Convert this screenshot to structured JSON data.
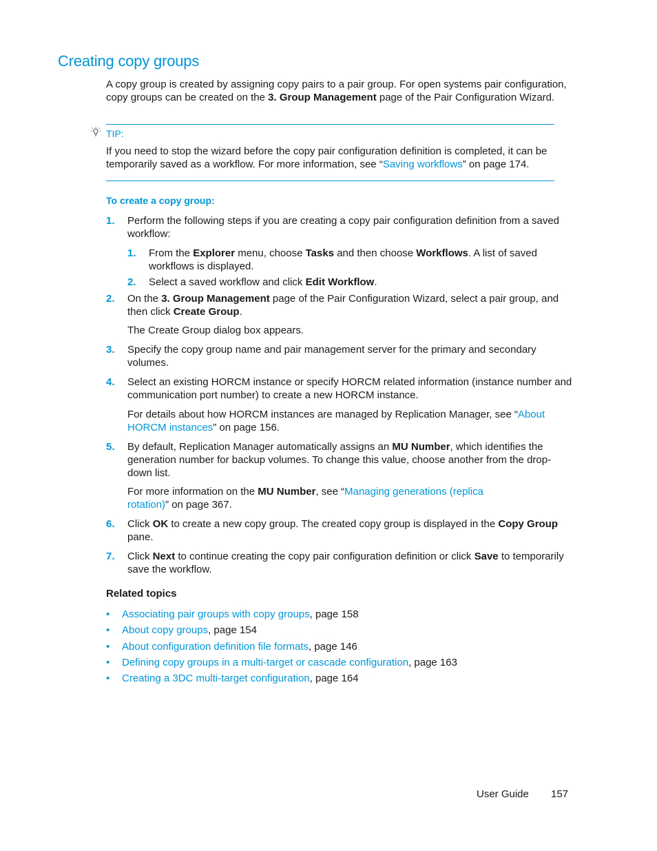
{
  "title": "Creating copy groups",
  "intro": {
    "t1": "A copy group is created by assigning copy pairs to a pair group. For open systems pair configuration, copy groups can be created on the ",
    "b1": "3. Group Management",
    "t2": " page of the Pair Configuration Wizard."
  },
  "tip": {
    "icon": "lightbulb-icon",
    "label": "TIP:",
    "t1": "If you need to stop the wizard before the copy pair configuration definition is completed, it can be temporarily saved as a workflow. For more information, see “",
    "link": "Saving workflows",
    "t2": "” on page 174."
  },
  "procedure": {
    "heading": "To create a copy group:",
    "steps": [
      {
        "num": "1.",
        "text": "Perform the following steps if you are creating a copy pair configuration definition from a saved workflow:",
        "substeps": [
          {
            "num": "1.",
            "t1": "From the ",
            "b1": "Explorer",
            "t2": " menu, choose ",
            "b2": "Tasks",
            "t3": " and then choose ",
            "b3": "Workflows",
            "t4": ". A list of saved workflows is displayed."
          },
          {
            "num": "2.",
            "t1": "Select a saved workflow and click ",
            "b1": "Edit Workflow",
            "t2": "."
          }
        ]
      },
      {
        "num": "2.",
        "t1": "On the ",
        "b1": "3. Group Management",
        "t2": " page of the Pair Configuration Wizard, select a pair group, and then click ",
        "b2": "Create Group",
        "t3": ".",
        "note": "The Create Group dialog box appears."
      },
      {
        "num": "3.",
        "text": "Specify the copy group name and pair management server for the primary and secondary volumes."
      },
      {
        "num": "4.",
        "text": "Select an existing HORCM instance or specify HORCM related information (instance number and communication port number) to create a new HORCM instance.",
        "note_t1": "For details about how HORCM instances are managed by Replication Manager, see “",
        "note_link": "About HORCM instances",
        "note_t2": "” on page 156."
      },
      {
        "num": "5.",
        "t1": "By default, Replication Manager automatically assigns an ",
        "b1": "MU Number",
        "t2": ", which identifies the generation number for backup volumes. To change this value, choose another from the drop-down list.",
        "note_t1": "For more information on the ",
        "note_b1": "MU Number",
        "note_t2": ", see “",
        "note_link": "Managing generations (replica rotation)",
        "note_t3": "” on page 367."
      },
      {
        "num": "6.",
        "t1": "Click ",
        "b1": "OK",
        "t2": " to create a new copy group. The created copy group is displayed in the ",
        "b2": "Copy Group",
        "t3": " pane."
      },
      {
        "num": "7.",
        "t1": "Click ",
        "b1": "Next",
        "t2": " to continue creating the copy pair configuration definition or click ",
        "b2": "Save",
        "t3": " to temporarily save the workflow."
      }
    ]
  },
  "related": {
    "heading": "Related topics",
    "bullet": "•",
    "items": [
      {
        "link": "Associating pair groups with copy groups",
        "suffix": ", page 158"
      },
      {
        "link": "About copy groups",
        "suffix": ", page 154"
      },
      {
        "link": "About configuration definition file formats",
        "suffix": ", page 146"
      },
      {
        "link": "Defining copy groups in a multi-target or cascade configuration",
        "suffix": ", page 163"
      },
      {
        "link": "Creating a 3DC multi-target configuration",
        "suffix": ", page 164"
      }
    ]
  },
  "footer": {
    "guide": "User Guide",
    "page": "157"
  }
}
